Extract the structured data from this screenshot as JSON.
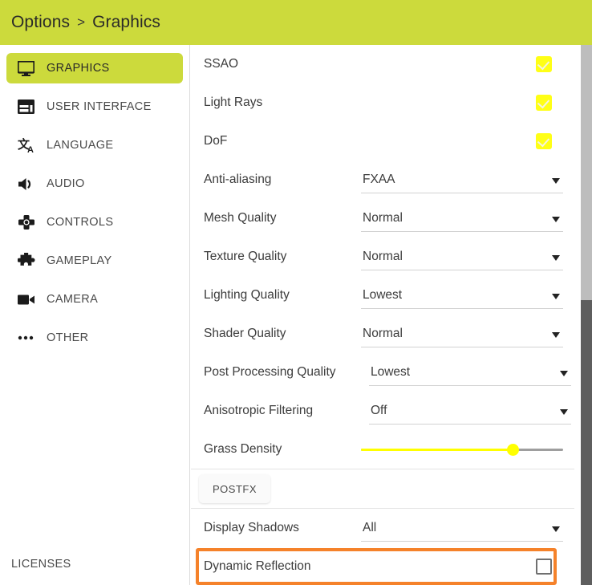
{
  "header": {
    "breadcrumb": [
      "Options",
      "Graphics"
    ],
    "separator": ">",
    "background": "#ccda3c"
  },
  "sidebar": {
    "items": [
      {
        "label": "GRAPHICS",
        "icon": "monitor-icon",
        "active": true
      },
      {
        "label": "USER INTERFACE",
        "icon": "layout-icon",
        "active": false
      },
      {
        "label": "LANGUAGE",
        "icon": "translate-icon",
        "active": false
      },
      {
        "label": "AUDIO",
        "icon": "speaker-icon",
        "active": false
      },
      {
        "label": "CONTROLS",
        "icon": "dpad-icon",
        "active": false
      },
      {
        "label": "GAMEPLAY",
        "icon": "puzzle-icon",
        "active": false
      },
      {
        "label": "CAMERA",
        "icon": "video-camera-icon",
        "active": false
      },
      {
        "label": "OTHER",
        "icon": "ellipsis-icon",
        "active": false
      }
    ],
    "licenses_label": "LICENSES"
  },
  "settings": {
    "checkbox_rows": [
      {
        "label": "SSAO",
        "checked": true
      },
      {
        "label": "Light Rays",
        "checked": true
      },
      {
        "label": "DoF",
        "checked": true
      }
    ],
    "dropdown_rows": [
      {
        "label": "Anti-aliasing",
        "value": "FXAA"
      },
      {
        "label": "Mesh Quality",
        "value": "Normal"
      },
      {
        "label": "Texture Quality",
        "value": "Normal"
      },
      {
        "label": "Lighting Quality",
        "value": "Lowest"
      },
      {
        "label": "Shader Quality",
        "value": "Normal"
      },
      {
        "label": "Post Processing Quality",
        "value": "Lowest"
      },
      {
        "label": "Anisotropic Filtering",
        "value": "Off"
      }
    ],
    "slider_row": {
      "label": "Grass Density",
      "percent": 75,
      "fill_color": "#ffff00",
      "track_color": "#9e9e9e"
    },
    "tabs": [
      {
        "label": "POSTFX",
        "selected": true
      }
    ],
    "bottom_rows": [
      {
        "label": "Display Shadows",
        "type": "dropdown",
        "value": "All"
      },
      {
        "label": "Dynamic Reflection",
        "type": "checkbox",
        "checked": false,
        "highlighted": true
      }
    ]
  },
  "highlight": {
    "color": "#f5822a"
  },
  "scrollbar": {
    "thumb_color": "#5e5e5e",
    "track_color": "#bdbdbd"
  }
}
